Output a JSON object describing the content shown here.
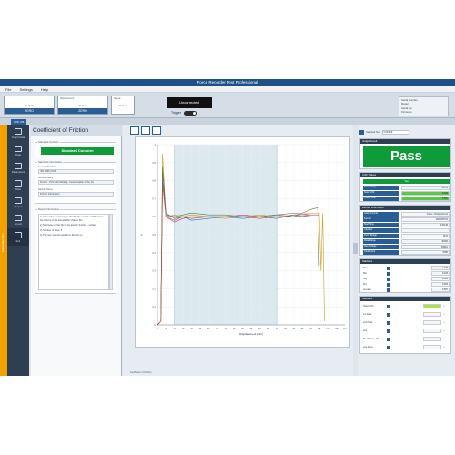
{
  "window": {
    "title": "Force Recorder Test Professional"
  },
  "menu": [
    "File",
    "Settings",
    "Help"
  ],
  "gauges": [
    {
      "label": "",
      "value": "– – –",
      "button": "ZERO"
    },
    {
      "label": "Displacement",
      "value": "– – –",
      "button": "ZERO"
    },
    {
      "label": "Speed",
      "value": "– – –",
      "button": ""
    }
  ],
  "uncorrected": "Uncorrected",
  "trigger": {
    "label": "Trigger"
  },
  "status_box": [
    "Serial Number",
    "Model",
    "Serial No.",
    "Firmware"
  ],
  "tab": "COF 2/6",
  "sidebar": {
    "vertical_label": "Force Recorder",
    "items": [
      {
        "label": "Graph Data"
      },
      {
        "label": "Data"
      },
      {
        "label": "Parameters"
      },
      {
        "label": "Data"
      },
      {
        "label": "Project"
      },
      {
        "label": "Import"
      },
      {
        "label": "Exit"
      }
    ]
  },
  "left": {
    "title": "Coefficient of Friction",
    "standard_group_label": "Standard Conform",
    "standard_button": "Standard Conform",
    "info_group_label": "Standard Information",
    "fields": [
      {
        "label": "General Standard",
        "value": "ISO 8295 (COF)"
      },
      {
        "label": "General Name",
        "value": "Friction - PVC with Marking - Determination of the Co"
      },
      {
        "label": "Sample Name",
        "value": "Friction Information"
      }
    ],
    "report_group_label": "Report Information",
    "report_text": [
      "1) Information necessary to identify the sample and/if known: the history of the sample film: Plastic film",
      "2) Test faces of the film to be tested: Surface - surface",
      "3) Number of tests: 5",
      "4) The test method used from film/film in..."
    ]
  },
  "chart_data": {
    "type": "line",
    "title": "",
    "xlabel": "Displacement [mm]",
    "ylabel": "μ",
    "xlim": [
      0,
      110
    ],
    "ylim": [
      0,
      1
    ],
    "x_ticks": [
      "0",
      "5",
      "10",
      "15",
      "20",
      "25",
      "30",
      "35",
      "40",
      "45",
      "50",
      "55",
      "60",
      "65",
      "70",
      "75",
      "80",
      "85",
      "90",
      "95",
      "100",
      "105",
      "110"
    ],
    "y_ticks": [
      "0",
      "0.1",
      "0.2",
      "0.3",
      "0.4",
      "0.5",
      "0.6",
      "0.7",
      "0.8",
      "0.9",
      "1"
    ],
    "shaded_region": [
      10,
      70
    ],
    "series": [
      {
        "color": "#d09a1e",
        "x": [
          0,
          2,
          3,
          5,
          10,
          15,
          20,
          30,
          40,
          50,
          60,
          70,
          80,
          90,
          95,
          96,
          97,
          98
        ],
        "y": [
          0,
          0.02,
          0.95,
          0.6,
          0.61,
          0.6,
          0.61,
          0.6,
          0.59,
          0.6,
          0.61,
          0.6,
          0.61,
          0.62,
          0.62,
          0.3,
          0.62,
          0.02
        ]
      },
      {
        "color": "#b23b8a",
        "x": [
          0,
          2,
          3,
          5,
          10,
          15,
          20,
          30,
          40,
          50,
          60,
          70,
          80,
          90,
          95
        ],
        "y": [
          0,
          0.02,
          0.85,
          0.6,
          0.57,
          0.59,
          0.6,
          0.6,
          0.6,
          0.61,
          0.6,
          0.61,
          0.62,
          0.61,
          0.61
        ]
      },
      {
        "color": "#4a8a3c",
        "x": [
          0,
          2,
          3,
          5,
          10,
          15,
          20,
          30,
          40,
          50,
          60,
          70,
          80,
          90,
          94,
          95
        ],
        "y": [
          0,
          0.02,
          0.88,
          0.61,
          0.6,
          0.61,
          0.62,
          0.61,
          0.61,
          0.6,
          0.6,
          0.61,
          0.6,
          0.64,
          0.65,
          0.33
        ]
      },
      {
        "color": "#3b6bb2",
        "x": [
          0,
          2,
          3,
          5,
          10,
          15,
          20,
          30,
          40,
          50,
          60,
          70,
          80,
          90
        ],
        "y": [
          0,
          0.02,
          0.8,
          0.62,
          0.59,
          0.6,
          0.58,
          0.59,
          0.6,
          0.59,
          0.6,
          0.59,
          0.61,
          0.6
        ]
      },
      {
        "color": "#c94a3a",
        "x": [
          0,
          2,
          3,
          5,
          10,
          15,
          20,
          30,
          40,
          50,
          60,
          70,
          80,
          90
        ],
        "y": [
          0,
          0.02,
          0.78,
          0.6,
          0.58,
          0.6,
          0.59,
          0.6,
          0.6,
          0.6,
          0.59,
          0.6,
          0.6,
          0.61
        ]
      }
    ]
  },
  "chart_footer": "Coefficient of Friction",
  "right": {
    "selector_label": "Selected Test",
    "selector_value": "COF 2/6",
    "judge_label": "Judge Result",
    "verdict": "Pass",
    "cof_label": "COF Values",
    "cof_status": "Yes",
    "cof_rows": [
      {
        "k": "Force Range",
        "v": "200 N",
        "green": false
      },
      {
        "k": "Static COF",
        "v": "0.528",
        "green": true
      },
      {
        "k": "Kinetic COF",
        "v": "0.582",
        "green": true
      }
    ],
    "record_label": "Record Information",
    "record_rows": [
      {
        "k": "Graph Format",
        "v": "Force - Displacement"
      },
      {
        "k": "Test ID",
        "v": "2020070731"
      },
      {
        "k": "Start Time",
        "v": "9:39:46"
      },
      {
        "k": "Operator",
        "v": ""
      },
      {
        "k": "Force Range",
        "v": "20 N"
      },
      {
        "k": "Data Range",
        "v": "40000"
      },
      {
        "k": "Record Rate",
        "v": "1000/s"
      },
      {
        "k": "Total Count",
        "v": "5000"
      }
    ],
    "stats_label": "Statistics",
    "stats_rows": [
      {
        "k": "Max",
        "v": "1.193"
      },
      {
        "k": "Min",
        "v": "0.013"
      },
      {
        "k": "Avg",
        "v": "0.555"
      },
      {
        "k": "Std",
        "v": "0.023"
      },
      {
        "k": "Average",
        "v": "0.557"
      }
    ],
    "stats2_label": "Statistics",
    "stats2_rows": [
      {
        "k": "Static COF",
        "v": "",
        "s": "/s",
        "green": true
      },
      {
        "k": "1st Peak",
        "v": "",
        "s": "/s",
        "green": false
      },
      {
        "k": "2nd Peak",
        "v": "",
        "s": "/s",
        "green": false
      },
      {
        "k": "Avg",
        "v": "",
        "s": "/s",
        "green": false
      },
      {
        "k": "Break Force, Pk",
        "v": "",
        "s": "/s",
        "green": false
      },
      {
        "k": "Avg Force",
        "v": "",
        "s": "/s",
        "green": false
      }
    ]
  }
}
